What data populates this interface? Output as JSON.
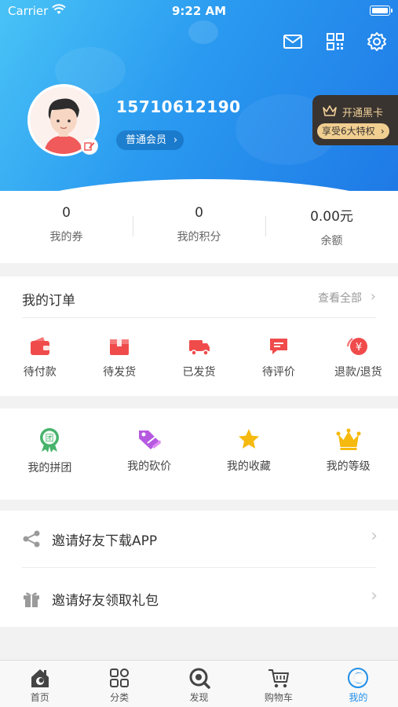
{
  "status_bar": {
    "carrier": "Carrier",
    "time": "9:22 AM"
  },
  "header": {
    "icons": [
      "message-icon",
      "qr-scan-icon",
      "settings-icon"
    ],
    "phone": "15710612190",
    "member_level": "普通会员",
    "black_card": {
      "title": "开通黑卡",
      "subtitle": "享受6大特权"
    }
  },
  "stats": [
    {
      "value": "0",
      "label": "我的券"
    },
    {
      "value": "0",
      "label": "我的积分"
    },
    {
      "value": "0.00元",
      "label": "余额"
    }
  ],
  "orders": {
    "title": "我的订单",
    "view_all": "查看全部",
    "items": [
      {
        "label": "待付款",
        "icon": "wallet-icon"
      },
      {
        "label": "待发货",
        "icon": "package-icon"
      },
      {
        "label": "已发货",
        "icon": "truck-icon"
      },
      {
        "label": "待评价",
        "icon": "comment-icon"
      },
      {
        "label": "退款/退货",
        "icon": "refund-icon"
      }
    ]
  },
  "tools": [
    {
      "label": "我的拼团",
      "icon": "group-buy-icon"
    },
    {
      "label": "我的砍价",
      "icon": "bargain-tag-icon"
    },
    {
      "label": "我的收藏",
      "icon": "star-icon"
    },
    {
      "label": "我的等级",
      "icon": "crown-icon"
    }
  ],
  "invites": [
    {
      "label": "邀请好友下载APP",
      "icon": "share-icon"
    },
    {
      "label": "邀请好友领取礼包",
      "icon": "gift-icon"
    }
  ],
  "tabbar": {
    "active": "我的",
    "items": [
      {
        "label": "首页",
        "icon": "home-icon"
      },
      {
        "label": "分类",
        "icon": "category-icon"
      },
      {
        "label": "发现",
        "icon": "discover-icon"
      },
      {
        "label": "购物车",
        "icon": "cart-icon"
      },
      {
        "label": "我的",
        "icon": "profile-icon"
      }
    ]
  },
  "colors": {
    "brand_blue": "#2a9af0",
    "accent_red": "#f04b4b",
    "gold": "#f1cf91",
    "active_tab": "#1e8ee8"
  }
}
